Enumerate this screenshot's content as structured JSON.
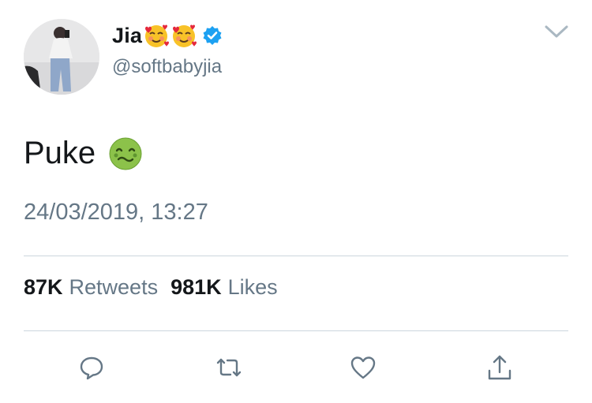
{
  "user": {
    "display_name": "Jia",
    "handle": "@softbabyjia",
    "name_emoji": [
      "smiling-face-with-hearts-icon",
      "smiling-face-with-hearts-icon"
    ],
    "verified": true
  },
  "tweet": {
    "text": "Puke",
    "text_emoji": "nauseated-face-icon",
    "timestamp": "24/03/2019, 13:27"
  },
  "stats": {
    "retweets_count": "87K",
    "retweets_label": "Retweets",
    "likes_count": "981K",
    "likes_label": "Likes"
  },
  "colors": {
    "text_primary": "#14171a",
    "text_secondary": "#657786",
    "divider": "#ccd6dd",
    "verified_blue": "#1da1f2",
    "icon_gray": "#657786"
  }
}
